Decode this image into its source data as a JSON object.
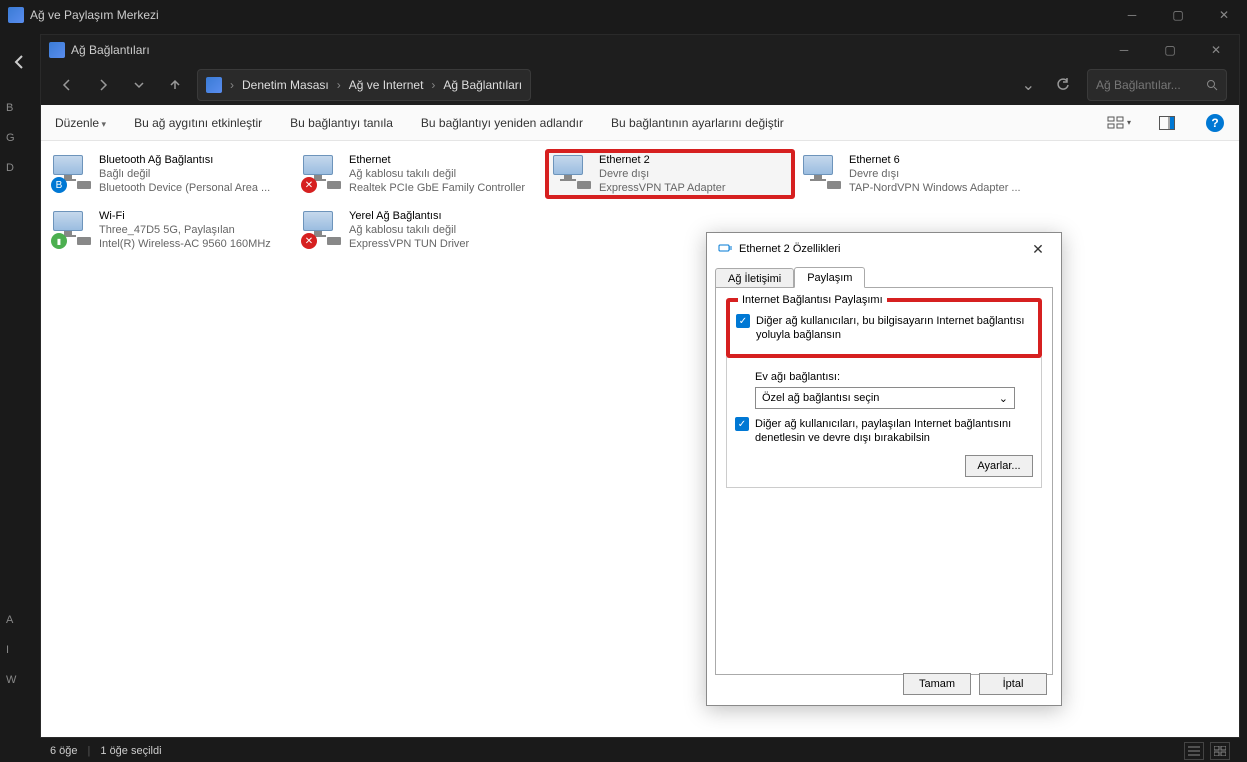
{
  "outer_window": {
    "title": "Ağ ve Paylaşım Merkezi",
    "side_letters": [
      "B",
      "G",
      "D"
    ],
    "side_lower": [
      "A",
      "I",
      "W"
    ]
  },
  "inner_window": {
    "title": "Ağ Bağlantıları",
    "breadcrumb": {
      "root": "Denetim Masası",
      "mid": "Ağ ve Internet",
      "leaf": "Ağ Bağlantıları"
    },
    "search_placeholder": "Ağ Bağlantılar..."
  },
  "toolbar": {
    "organize": "Düzenle",
    "enable": "Bu ağ aygıtını etkinleştir",
    "diagnose": "Bu bağlantıyı tanıla",
    "rename": "Bu bağlantıyı yeniden adlandır",
    "settings": "Bu bağlantının ayarlarını değiştir"
  },
  "connections": [
    {
      "name": "Bluetooth Ağ Bağlantısı",
      "status": "Bağlı değil",
      "device": "Bluetooth Device (Personal Area ...",
      "overlay": "blue"
    },
    {
      "name": "Ethernet",
      "status": "Ağ kablosu takılı değil",
      "device": "Realtek PCIe GbE Family Controller",
      "overlay": "red"
    },
    {
      "name": "Ethernet 2",
      "status": "Devre dışı",
      "device": "ExpressVPN TAP Adapter",
      "overlay": "none",
      "highlighted": true
    },
    {
      "name": "Ethernet 6",
      "status": "Devre dışı",
      "device": "TAP-NordVPN Windows Adapter ...",
      "overlay": "none"
    },
    {
      "name": "Wi-Fi",
      "status": "Three_47D5 5G, Paylaşılan",
      "device": "Intel(R) Wireless-AC 9560 160MHz",
      "overlay": "wifi"
    },
    {
      "name": "Yerel Ağ Bağlantısı",
      "status": "Ağ kablosu takılı değil",
      "device": "ExpressVPN TUN Driver",
      "overlay": "red"
    }
  ],
  "dialog": {
    "title": "Ethernet 2 Özellikleri",
    "tabs": {
      "networking": "Ağ İletişimi",
      "sharing": "Paylaşım"
    },
    "group_legend": "Internet Bağlantısı Paylaşımı",
    "chk1": "Diğer ağ kullanıcıları, bu bilgisayarın Internet bağlantısı yoluyla bağlansın",
    "home_label": "Ev ağı bağlantısı:",
    "home_select": "Özel ağ bağlantısı seçin",
    "chk2": "Diğer ağ kullanıcıları, paylaşılan Internet bağlantısını denetlesin ve devre dışı bırakabilsin",
    "settings_btn": "Ayarlar...",
    "ok": "Tamam",
    "cancel": "İptal"
  },
  "statusbar": {
    "items": "6 öğe",
    "selected": "1 öğe seçildi"
  }
}
